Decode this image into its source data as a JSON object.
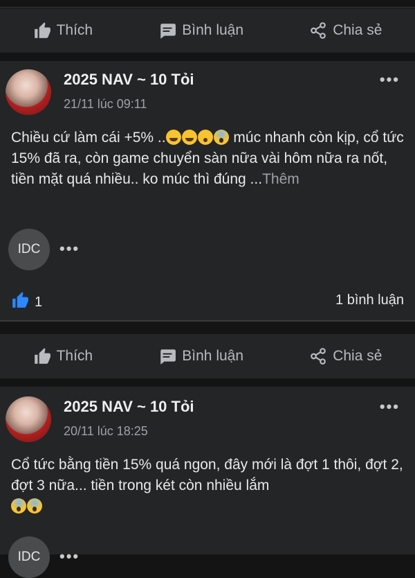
{
  "actions": {
    "like_label": "Thích",
    "comment_label": "Bình luận",
    "share_label": "Chia sẻ"
  },
  "posts": [
    {
      "author": "2025 NAV ~ 10 Tỏi",
      "time": "21/11 lúc 09:11",
      "content_lines": [
        "Chiều cứ làm cái +5% ..",
        "múc nhanh còn kịp, cổ tức 15% đã ra, còn game chuyển sàn nữa vài hôm nữa ra nốt, tiền mặt quá nhiều.. ko múc thì đúng ..."
      ],
      "see_more": "Thêm",
      "emojis": [
        "rofl-emoji",
        "rofl-emoji",
        "surprised-emoji",
        "scream-emoji"
      ],
      "commenter_initials": "IDC",
      "likes": "1",
      "comments": "1 bình luận"
    },
    {
      "author": "2025 NAV ~ 10 Tỏi",
      "time": "20/11 lúc 18:25",
      "content": "Cổ tức bằng tiền 15% quá ngon, đây mới là đợt 1 thôi, đợt 2, đợt 3 nữa... tiền trong két còn nhiều lắm",
      "emojis": [
        "scream-emoji",
        "scream-emoji"
      ],
      "commenter_initials": "IDC"
    }
  ],
  "more_dots": "•••",
  "colors": {
    "background": "#141414",
    "card": "#242526",
    "accent_like": "#2d88ff",
    "muted": "#9ea2a7"
  }
}
